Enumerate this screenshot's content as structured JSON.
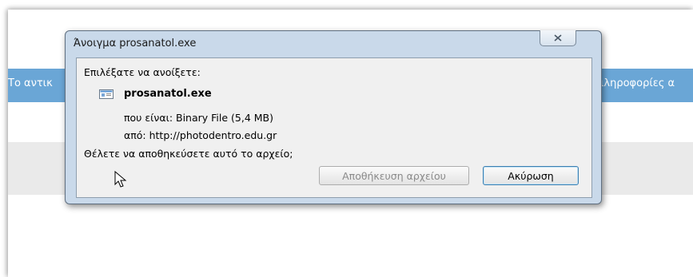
{
  "background_page": {
    "info_left": "Το αντικ",
    "info_right": "ιληροφορίες α"
  },
  "dialog": {
    "title": "Άνοιγμα prosanatol.exe",
    "close_icon": "close-icon",
    "prompt": "Επιλέξατε να ανοίξετε:",
    "file_icon": "executable-file-icon",
    "file_name": "prosanatol.exe",
    "type_line": "που είναι:  Binary File (5,4 MB)",
    "from_line": "από:  http://photodentro.edu.gr",
    "question": "Θέλετε να αποθηκεύσετε αυτό το αρχείο;",
    "save_button": "Αποθήκευση αρχείου",
    "cancel_button": "Ακύρωση"
  },
  "colors": {
    "info_bar": "#6aa6d6",
    "dialog_frame": "#c9d9ea",
    "dialog_content": "#f0f0f0"
  }
}
